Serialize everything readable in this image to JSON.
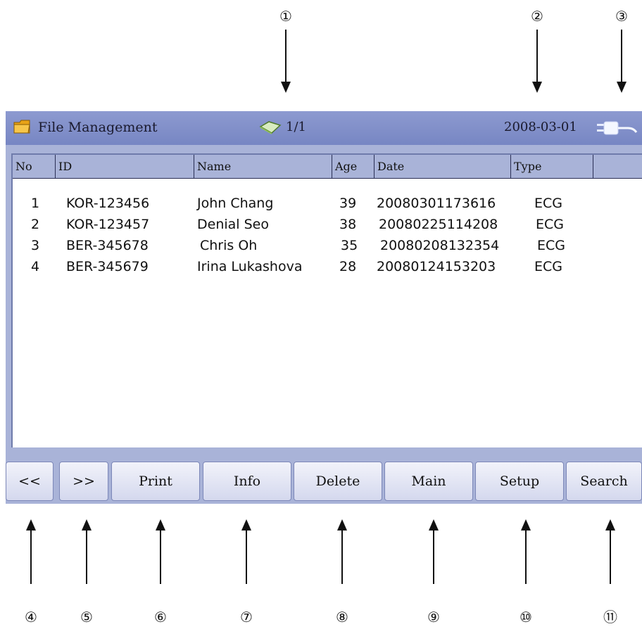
{
  "callouts": {
    "top": [
      "①",
      "②",
      "③"
    ],
    "bottom": [
      "④",
      "⑤",
      "⑥",
      "⑦",
      "⑧",
      "⑨",
      "⑩",
      "⑪"
    ]
  },
  "titlebar": {
    "icon": "folder-icon",
    "title": "File Management",
    "page_icon": "book-icon",
    "page_indicator": "1/1",
    "date": "2008-03-01",
    "power_icon": "plug-icon"
  },
  "table": {
    "headers": [
      "No",
      "ID",
      "Name",
      "Age",
      "Date",
      "Type",
      ""
    ],
    "rows": [
      {
        "no": "1",
        "id": "KOR-123456",
        "name": "John Chang",
        "age": "39",
        "date": "20080301173616",
        "type": "ECG"
      },
      {
        "no": "2",
        "id": "KOR-123457",
        "name": "Denial Seo",
        "age": "38",
        "date": "20080225114208",
        "type": "ECG"
      },
      {
        "no": "3",
        "id": "BER-345678",
        "name": "Chris Oh",
        "age": "35",
        "date": "20080208132354",
        "type": "ECG"
      },
      {
        "no": "4",
        "id": "BER-345679",
        "name": "Irina Lukashova",
        "age": "28",
        "date": "20080124153203",
        "type": "ECG"
      }
    ]
  },
  "buttons": {
    "prev": "<<",
    "next": ">>",
    "print": "Print",
    "info": "Info",
    "delete": "Delete",
    "main": "Main",
    "setup": "Setup",
    "search": "Search"
  },
  "colors": {
    "titlebar": "#7f8dc8",
    "panel": "#a9b3d8",
    "button": "#e6e8f5"
  }
}
